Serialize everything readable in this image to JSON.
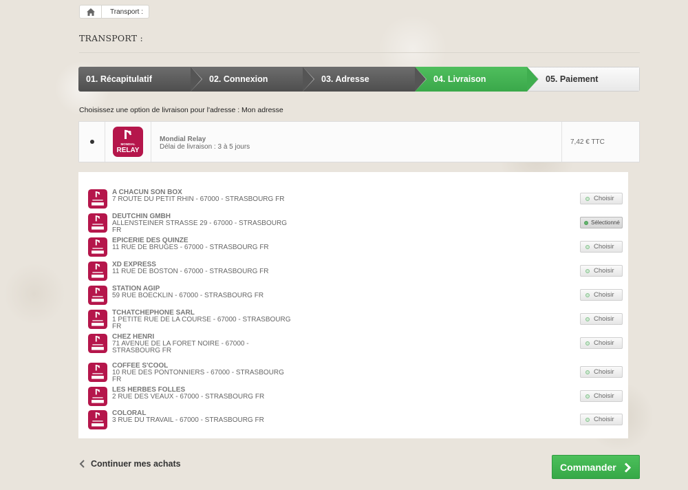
{
  "breadcrumb": {
    "home_icon": "home-icon",
    "current": "Transport :"
  },
  "page_title": "TRANSPORT :",
  "steps": [
    {
      "label": "01. Récapitulatif",
      "state": "done"
    },
    {
      "label": "02. Connexion",
      "state": "done"
    },
    {
      "label": "03. Adresse",
      "state": "done"
    },
    {
      "label": "04. Livraison",
      "state": "active"
    },
    {
      "label": "05. Paiement",
      "state": "todo"
    }
  ],
  "colors": {
    "accent_green": "#3fae4f",
    "step_dark": "#5a5a5a",
    "relay_brand": "#b5164b"
  },
  "delivery": {
    "choose_text": "Choisissez une option de livraison pour l'adresse : Mon adresse",
    "carrier_name": "Mondial Relay",
    "carrier_delay": "Délai de livraison : 3 à 5 jours",
    "price": "7,42 € TTC",
    "logo_text_top": "MONDIAL",
    "logo_text_bottom": "RELAY"
  },
  "relays": [
    {
      "name": "A CHACUN SON BOX",
      "address": "7 ROUTE DU PETIT RHIN - 67000 - STRASBOURG FR",
      "button": "Choisir",
      "selected": false
    },
    {
      "name": "DEUTCHIN GMBH",
      "address": "ALLENSTEINER STRASSE 29 - 67000 - STRASBOURG FR",
      "button": "Sélectionné",
      "selected": true
    },
    {
      "name": "EPICERIE DES QUINZE",
      "address": "11 RUE DE BRUGES - 67000 - STRASBOURG FR",
      "button": "Choisir",
      "selected": false
    },
    {
      "name": "XD EXPRESS",
      "address": "11 RUE DE BOSTON - 67000 - STRASBOURG FR",
      "button": "Choisir",
      "selected": false
    },
    {
      "name": "STATION AGIP",
      "address": "59 RUE BOECKLIN - 67000 - STRASBOURG FR",
      "button": "Choisir",
      "selected": false
    },
    {
      "name": "TCHATCHEPHONE SARL",
      "address": "1 PETITE RUE DE LA COURSE - 67000 - STRASBOURG FR",
      "button": "Choisir",
      "selected": false
    },
    {
      "name": "CHEZ HENRI",
      "address": "71 AVENUE DE LA FORET NOIRE - 67000 - STRASBOURG FR",
      "button": "Choisir",
      "selected": false
    },
    {
      "name": "COFFEE S'COOL",
      "address": "10 RUE DES PONTONNIERS - 67000 - STRASBOURG FR",
      "button": "Choisir",
      "selected": false
    },
    {
      "name": "LES HERBES FOLLES",
      "address": "2 RUE DES VEAUX - 67000 - STRASBOURG FR",
      "button": "Choisir",
      "selected": false
    },
    {
      "name": "COLORAL",
      "address": "3 RUE DU TRAVAIL - 67000 - STRASBOURG FR",
      "button": "Choisir",
      "selected": false
    }
  ],
  "footer": {
    "continue_label": "Continuer mes achats",
    "order_label": "Commander"
  }
}
